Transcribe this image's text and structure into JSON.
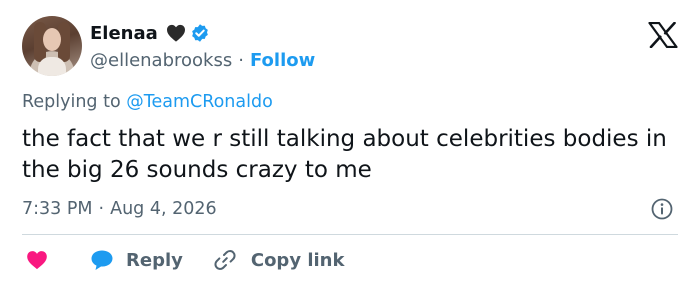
{
  "author": {
    "name": "Elenaa",
    "handle": "@ellenabrookss",
    "separator": "·",
    "follow_label": "Follow",
    "badge_icon": "black-heart-icon",
    "verified_icon": "verified-badge-icon",
    "verified_color": "#1d9bf0"
  },
  "platform_icon": "x-logo-icon",
  "reply_context": {
    "prefix": "Replying to",
    "mention": "@TeamCRonaldo"
  },
  "tweet": {
    "text": "the fact that we r still talking about celebrities bodies in the big 26 sounds crazy to me"
  },
  "meta": {
    "time": "7:33 PM",
    "separator": "·",
    "date": "Aug 4, 2026",
    "info_icon": "info-icon"
  },
  "actions": {
    "like_icon": "heart-icon",
    "like_color": "#f91880",
    "reply_label": "Reply",
    "reply_icon": "speech-bubble-icon",
    "reply_color": "#1d9bf0",
    "copy_label": "Copy link",
    "copy_icon": "link-icon"
  },
  "colors": {
    "text": "#0f1419",
    "secondary": "#536471",
    "accent": "#1d9bf0",
    "divider": "#cfd9de"
  }
}
